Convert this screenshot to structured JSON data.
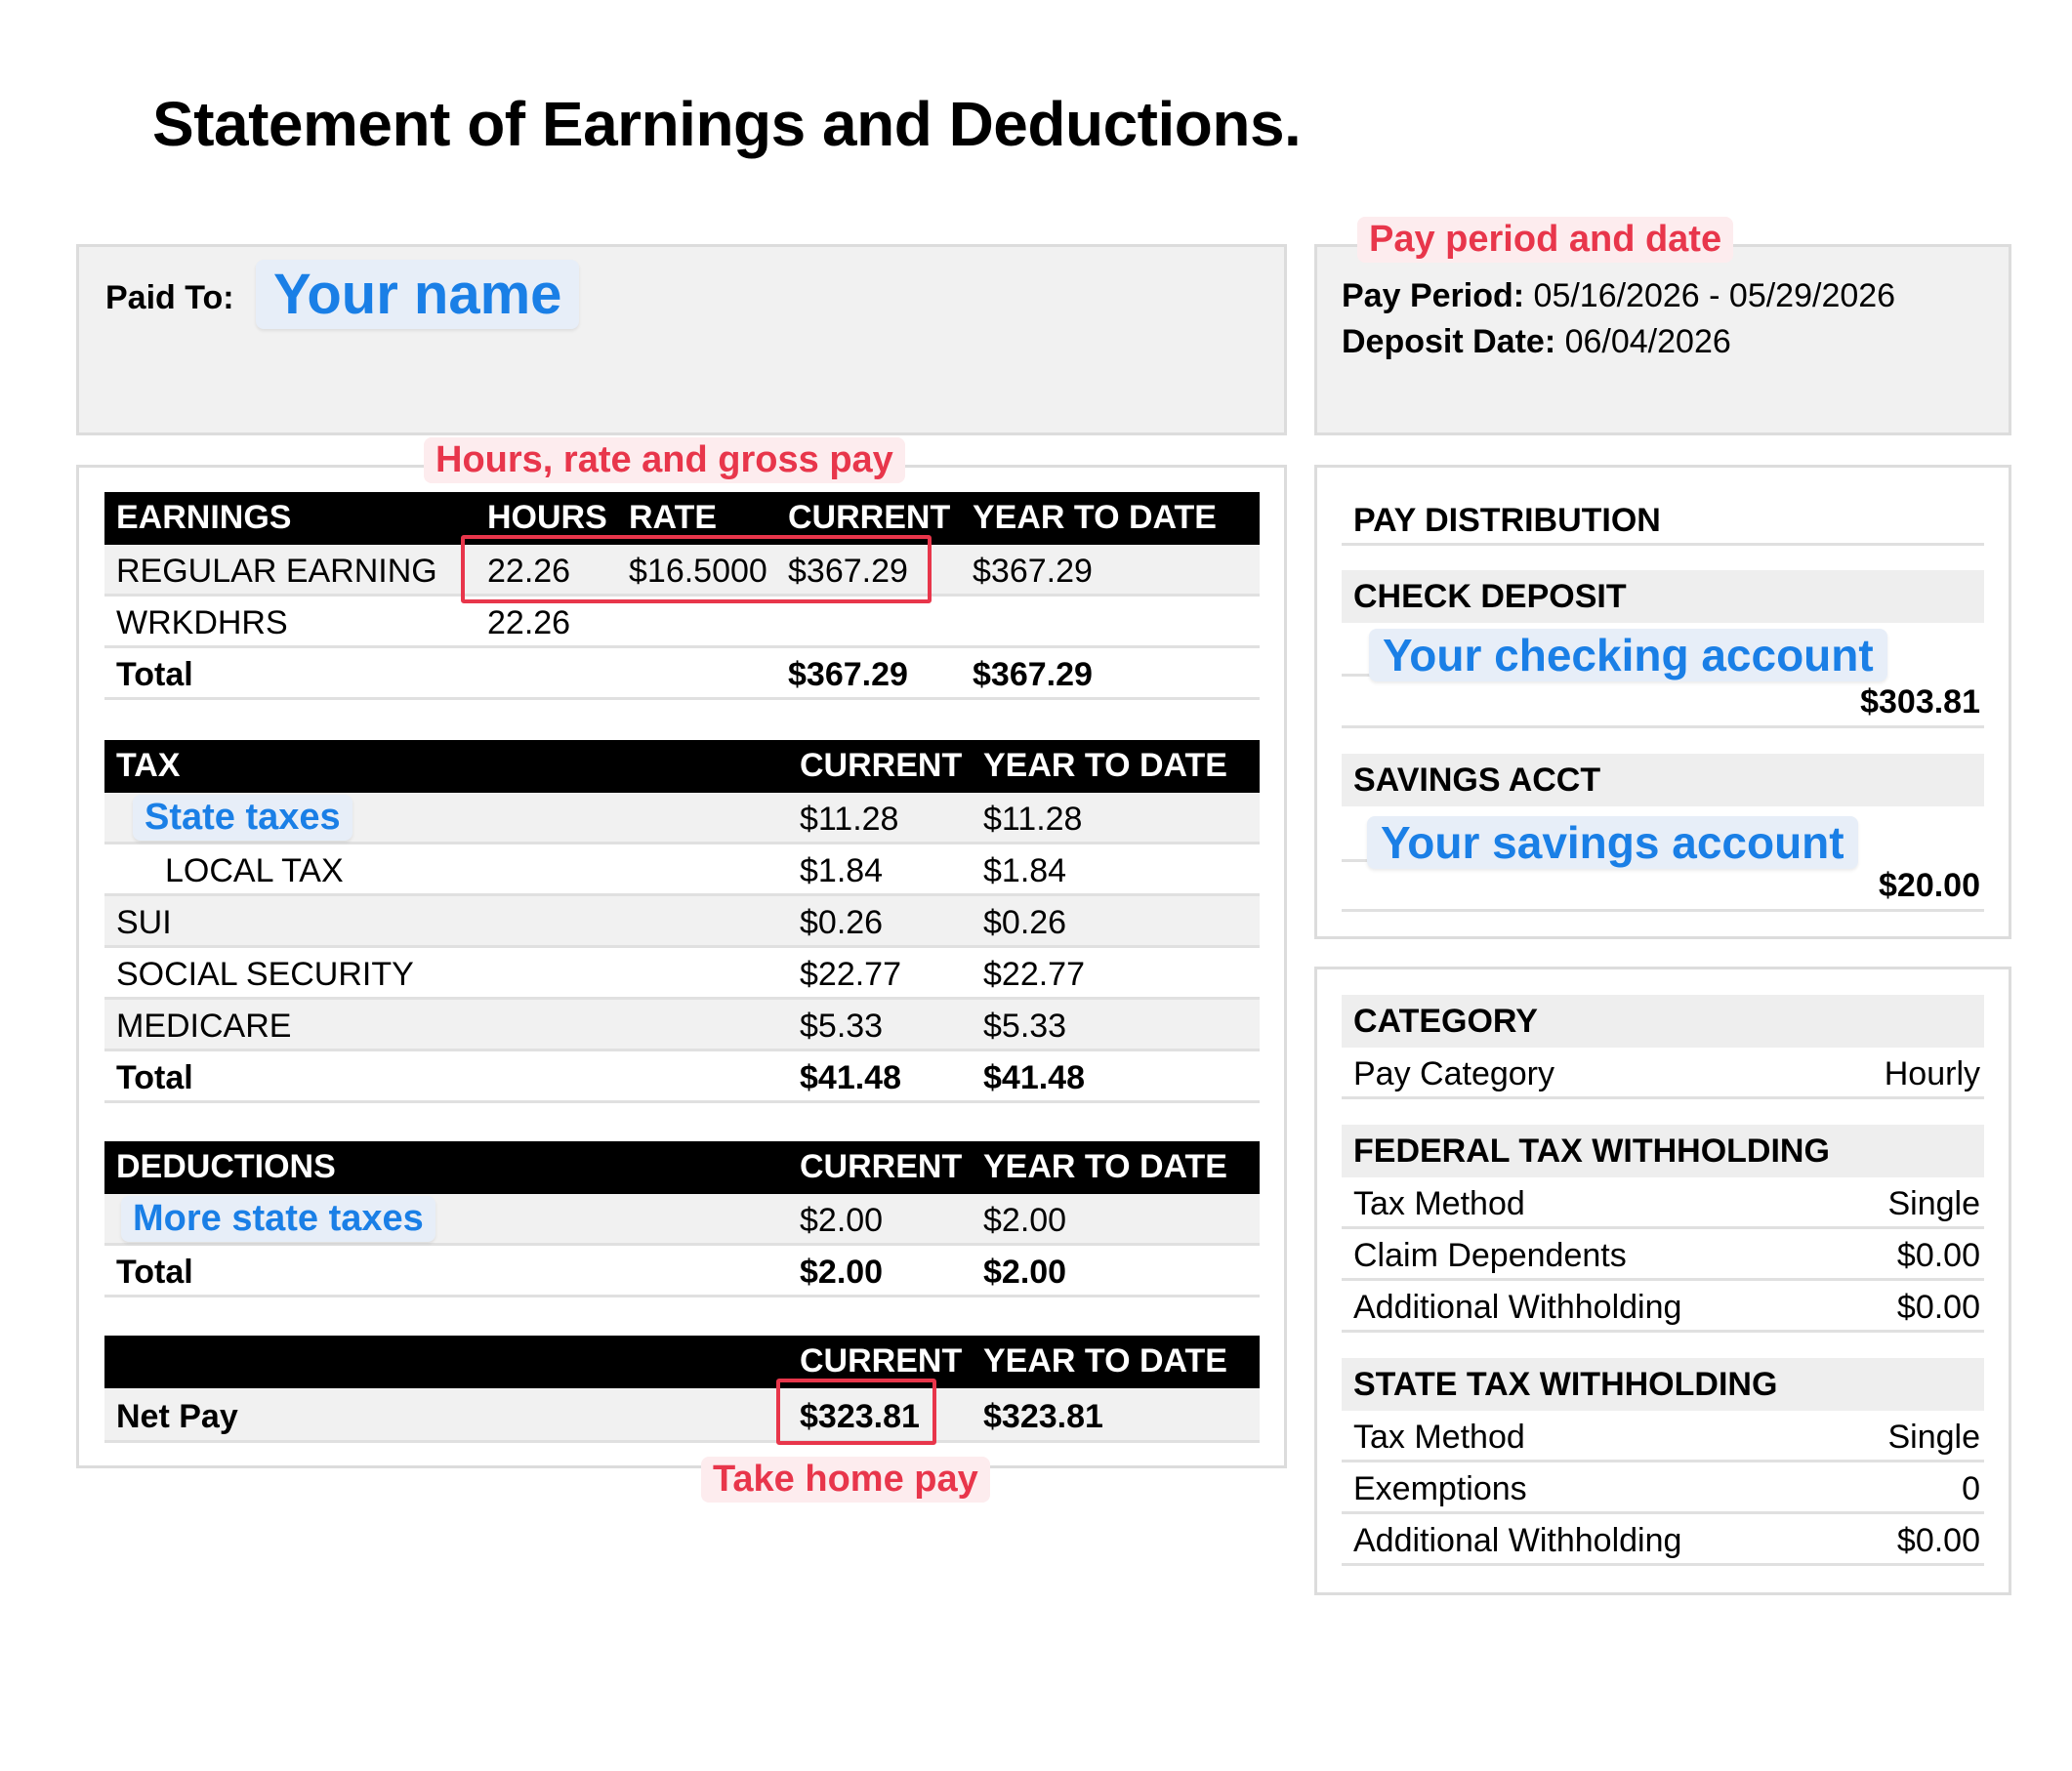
{
  "title": "Statement of Earnings and Deductions.",
  "paid_to": {
    "label": "Paid To:",
    "value": "Your name"
  },
  "pay_info": {
    "callout": "Pay period and date",
    "period_label": "Pay Period:",
    "period_value": "05/16/2026 - 05/29/2026",
    "deposit_label": "Deposit Date:",
    "deposit_value": "06/04/2026"
  },
  "earnings": {
    "callout": "Hours, rate and gross pay",
    "headers": [
      "EARNINGS",
      "HOURS",
      "RATE",
      "CURRENT",
      "YEAR TO DATE"
    ],
    "rows": [
      {
        "label": "REGULAR EARNING",
        "hours": "22.26",
        "rate": "$16.5000",
        "current": "$367.29",
        "ytd": "$367.29"
      },
      {
        "label": "WRKDHRS",
        "hours": "22.26",
        "rate": "",
        "current": "",
        "ytd": ""
      }
    ],
    "total": {
      "label": "Total",
      "current": "$367.29",
      "ytd": "$367.29"
    }
  },
  "tax": {
    "headers": [
      "TAX",
      "CURRENT",
      "YEAR TO DATE"
    ],
    "rows": [
      {
        "label": "State taxes",
        "current": "$11.28",
        "ytd": "$11.28"
      },
      {
        "label": "LOCAL TAX",
        "current": "$1.84",
        "ytd": "$1.84"
      },
      {
        "label": "SUI",
        "current": "$0.26",
        "ytd": "$0.26"
      },
      {
        "label": "SOCIAL SECURITY",
        "current": "$22.77",
        "ytd": "$22.77"
      },
      {
        "label": "MEDICARE",
        "current": "$5.33",
        "ytd": "$5.33"
      }
    ],
    "total": {
      "label": "Total",
      "current": "$41.48",
      "ytd": "$41.48"
    }
  },
  "deductions": {
    "headers": [
      "DEDUCTIONS",
      "CURRENT",
      "YEAR TO DATE"
    ],
    "rows": [
      {
        "label": "More state taxes",
        "current": "$2.00",
        "ytd": "$2.00"
      }
    ],
    "total": {
      "label": "Total",
      "current": "$2.00",
      "ytd": "$2.00"
    }
  },
  "net_pay": {
    "headers": [
      "CURRENT",
      "YEAR TO DATE"
    ],
    "label": "Net Pay",
    "current": "$323.81",
    "ytd": "$323.81",
    "callout": "Take home pay"
  },
  "distribution": {
    "title": "PAY DISTRIBUTION",
    "check": {
      "header": "CHECK DEPOSIT",
      "account": "Your checking account",
      "amount": "$303.81"
    },
    "savings": {
      "header": "SAVINGS ACCT",
      "account": "Your savings account",
      "amount": "$20.00"
    }
  },
  "category": {
    "header": "CATEGORY",
    "rows": [
      {
        "label": "Pay Category",
        "value": "Hourly"
      }
    ]
  },
  "federal": {
    "header": "FEDERAL TAX WITHHOLDING",
    "rows": [
      {
        "label": "Tax Method",
        "value": "Single"
      },
      {
        "label": "Claim Dependents",
        "value": "$0.00"
      },
      {
        "label": "Additional Withholding",
        "value": "$0.00"
      }
    ]
  },
  "state": {
    "header": "STATE TAX WITHHOLDING",
    "rows": [
      {
        "label": "Tax Method",
        "value": "Single"
      },
      {
        "label": "Exemptions",
        "value": "0"
      },
      {
        "label": "Additional Withholding",
        "value": "$0.00"
      }
    ]
  },
  "colors": {
    "accent_blue": "#1a7fe6",
    "accent_red": "#e8364b",
    "panel_grey": "#f1f1f1"
  }
}
